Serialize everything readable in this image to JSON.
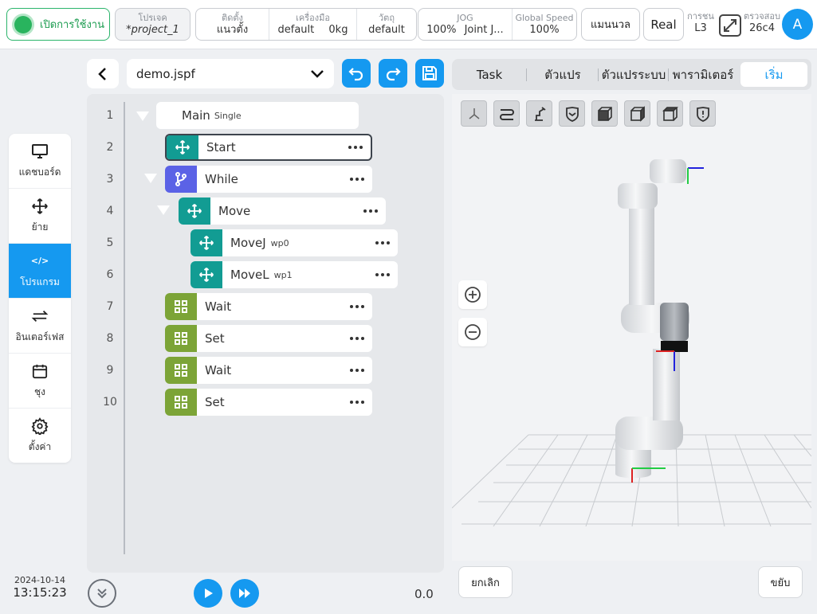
{
  "topbar": {
    "enable_label": "เปิดการใช้งาน",
    "project": {
      "caption": "โปรเจค",
      "value": "*project_1"
    },
    "install": {
      "setup_caption": "ติดตั้ง",
      "setup_value": "แนวตั้ง",
      "tool_caption": "เครื่องมือ",
      "tool_value": "default",
      "tool_weight": "0kg",
      "object_caption": "วัตถุ",
      "object_value": "default"
    },
    "jog": {
      "caption": "JOG",
      "value": "100%",
      "mode": "Joint J...",
      "speed_caption": "Global Speed",
      "speed_value": "100%"
    },
    "manual_label": "แมนนวล",
    "real_label": "Real",
    "collision": {
      "caption": "การชน",
      "value": "L3"
    },
    "check": {
      "caption": "ตรวจสอบ",
      "value": "26c4"
    },
    "avatar_letter": "A"
  },
  "sidebar": {
    "items": [
      {
        "label": "แดชบอร์ด",
        "icon": "monitor-icon"
      },
      {
        "label": "ย้าย",
        "icon": "move-icon"
      },
      {
        "label": "โปรแกรม",
        "icon": "code-icon"
      },
      {
        "label": "อินเตอร์เฟส",
        "icon": "interface-icon"
      },
      {
        "label": "ชุง",
        "icon": "calendar-icon"
      },
      {
        "label": "ตั้งค่า",
        "icon": "gear-icon"
      }
    ],
    "active_index": 2,
    "date": "2024-10-14",
    "time": "13:15:23"
  },
  "program": {
    "file_name": "demo.jspf",
    "root": {
      "label": "Main",
      "mode": "Single"
    },
    "line_numbers": [
      "1",
      "2",
      "3",
      "4",
      "5",
      "6",
      "7",
      "8",
      "9",
      "10"
    ],
    "nodes": [
      {
        "label": "Start",
        "sub": "",
        "type": "move"
      },
      {
        "label": "While",
        "sub": "",
        "type": "branch"
      },
      {
        "label": "Move",
        "sub": "",
        "type": "move"
      },
      {
        "label": "MoveJ",
        "sub": "wp0",
        "type": "move"
      },
      {
        "label": "MoveL",
        "sub": "wp1",
        "type": "move"
      },
      {
        "label": "Wait",
        "sub": "",
        "type": "grid"
      },
      {
        "label": "Set",
        "sub": "",
        "type": "grid"
      },
      {
        "label": "Wait",
        "sub": "",
        "type": "grid"
      },
      {
        "label": "Set",
        "sub": "",
        "type": "grid"
      }
    ],
    "speed_value": "0.0"
  },
  "right": {
    "tabs": [
      "Task",
      "ตัวแปร",
      "ตัวแปรระบบ",
      "พารามิเตอร์",
      "เริ่ม"
    ],
    "active_tab": 4,
    "cancel_label": "ยกเลิก",
    "move_label": "ขยับ"
  },
  "colors": {
    "accent": "#1599f0",
    "enable": "#29b45e",
    "teal": "#129c93",
    "purple": "#5b62e6",
    "olive": "#7ca437"
  }
}
